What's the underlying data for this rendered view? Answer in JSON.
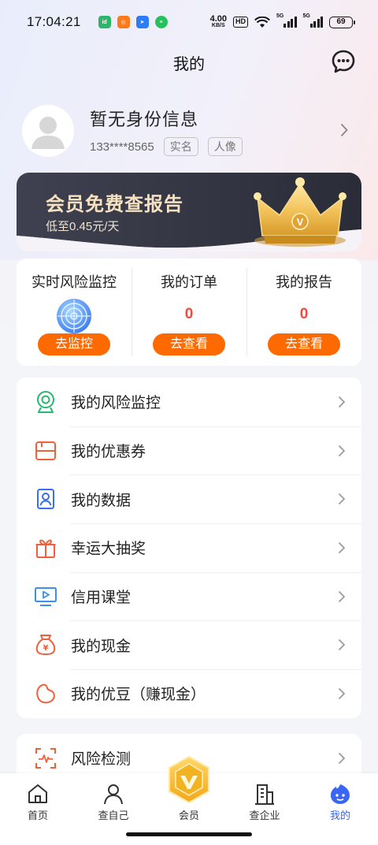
{
  "status_bar": {
    "time": "17:04:21",
    "net_speed_value": "4.00",
    "net_speed_unit": "KB/S",
    "hd": "HD",
    "sim1": "5G",
    "sim2": "5G",
    "battery": "69"
  },
  "header": {
    "title": "我的",
    "message_icon": "chat-bubble-icon"
  },
  "profile": {
    "name": "暂无身份信息",
    "phone": "133****8565",
    "tags": [
      "实名",
      "人像"
    ]
  },
  "vip_banner": {
    "title": "会员免费查报告",
    "subtitle": "低至0.45元/天",
    "badge_letter": "V"
  },
  "quick": [
    {
      "title": "实时风险监控",
      "button": "去监控",
      "icon": "radar-icon"
    },
    {
      "title": "我的订单",
      "count": "0",
      "button": "去查看"
    },
    {
      "title": "我的报告",
      "count": "0",
      "button": "去查看"
    }
  ],
  "menu": [
    {
      "label": "我的风险监控",
      "icon": "webcam-icon",
      "color": "#2bb673"
    },
    {
      "label": "我的优惠券",
      "icon": "coupon-icon",
      "color": "#f0603c"
    },
    {
      "label": "我的数据",
      "icon": "user-data-icon",
      "color": "#3a6ff2"
    },
    {
      "label": "幸运大抽奖",
      "icon": "gift-icon",
      "color": "#f0603c"
    },
    {
      "label": "信用课堂",
      "icon": "video-monitor-icon",
      "color": "#3a8ff2"
    },
    {
      "label": "我的现金",
      "icon": "money-bag-icon",
      "color": "#f0603c"
    },
    {
      "label": "我的优豆（赚现金）",
      "icon": "bean-icon",
      "color": "#f0603c"
    }
  ],
  "menu2": [
    {
      "label": "风险检测",
      "icon": "scan-pulse-icon",
      "color": "#f0603c"
    }
  ],
  "tabs": [
    {
      "label": "首页",
      "icon": "home-icon"
    },
    {
      "label": "查自己",
      "icon": "person-icon"
    },
    {
      "label": "会员",
      "icon": "vip-hexagon-icon"
    },
    {
      "label": "查企业",
      "icon": "building-icon"
    },
    {
      "label": "我的",
      "icon": "mine-icon",
      "active": true
    }
  ],
  "colors": {
    "accent_orange": "#ff6a00",
    "count_red": "#f04a3e",
    "active_tab": "#3a66f1",
    "vip_gold": "#f6e2c0"
  }
}
